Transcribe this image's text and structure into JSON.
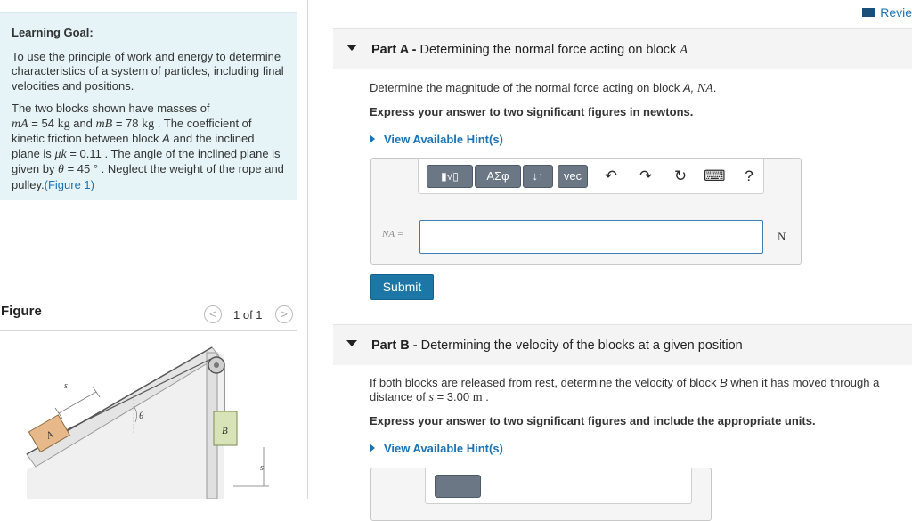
{
  "learning_goal": {
    "heading": "Learning Goal:",
    "goal_text": "To use the principle of work and energy to determine characteristics of a system of particles, including final velocities and positions.",
    "given": {
      "intro": "The two blocks shown have masses of",
      "mA_sym": "mA",
      "mA_val": "= 54",
      "mA_unit": "kg",
      "and": "and",
      "mB_sym": "mB",
      "mB_val": "= 78",
      "mB_unit": "kg",
      "friction_text": ". The coefficient of kinetic friction between block",
      "blockA": "A",
      "incline_text": "and the inclined plane is",
      "mu_sym": "μk",
      "mu_val": "= 0.11",
      "angle_text": ". The angle of the inclined plane is given by",
      "theta_sym": "θ",
      "theta_val": "= 45 °",
      "neglect_text": ". Neglect the weight of the rope and pulley.",
      "figure_link": "(Figure 1)"
    }
  },
  "figure": {
    "title": "Figure",
    "counter": "1 of 1",
    "prev": "<",
    "next": ">",
    "labels": {
      "s_incline": "s",
      "theta": "θ",
      "block_a": "A",
      "block_b": "B",
      "s_vertical": "s"
    }
  },
  "review": {
    "label": "Revie"
  },
  "part_a": {
    "part": "Part A -",
    "title": "Determining the normal force acting on block",
    "title_var": "A",
    "prompt": "Determine the magnitude of the normal force acting on block",
    "prompt_var": "A,",
    "prompt_sym": "NA",
    "prompt_end": ".",
    "instruction": "Express your answer to two significant figures in newtons.",
    "hint": "View Available Hint(s)",
    "answer_label": "NA =",
    "answer_value": "",
    "unit": "N",
    "submit": "Submit"
  },
  "toolbar": {
    "templates": "▮√▯",
    "greek": "ΑΣφ",
    "arrows": "↓↑",
    "vec": "vec",
    "undo": "↶",
    "redo": "↷",
    "reset": "↻",
    "keyboard": "⌨",
    "help": "?"
  },
  "part_b": {
    "part": "Part B -",
    "title": "Determining the velocity of the blocks at a given position",
    "prompt_1": "If both blocks are released from rest, determine the velocity of block",
    "prompt_var": "B",
    "prompt_2": "when it has moved through a distance of",
    "s_sym": "s",
    "s_val": "= 3.00",
    "s_unit": "m",
    "prompt_end": ".",
    "instruction": "Express your answer to two significant figures and include the appropriate units.",
    "hint": "View Available Hint(s)"
  },
  "colors": {
    "accent": "#1a73b6",
    "goal_bg": "#e6f4f7",
    "submit_bg": "#1d77a6"
  }
}
